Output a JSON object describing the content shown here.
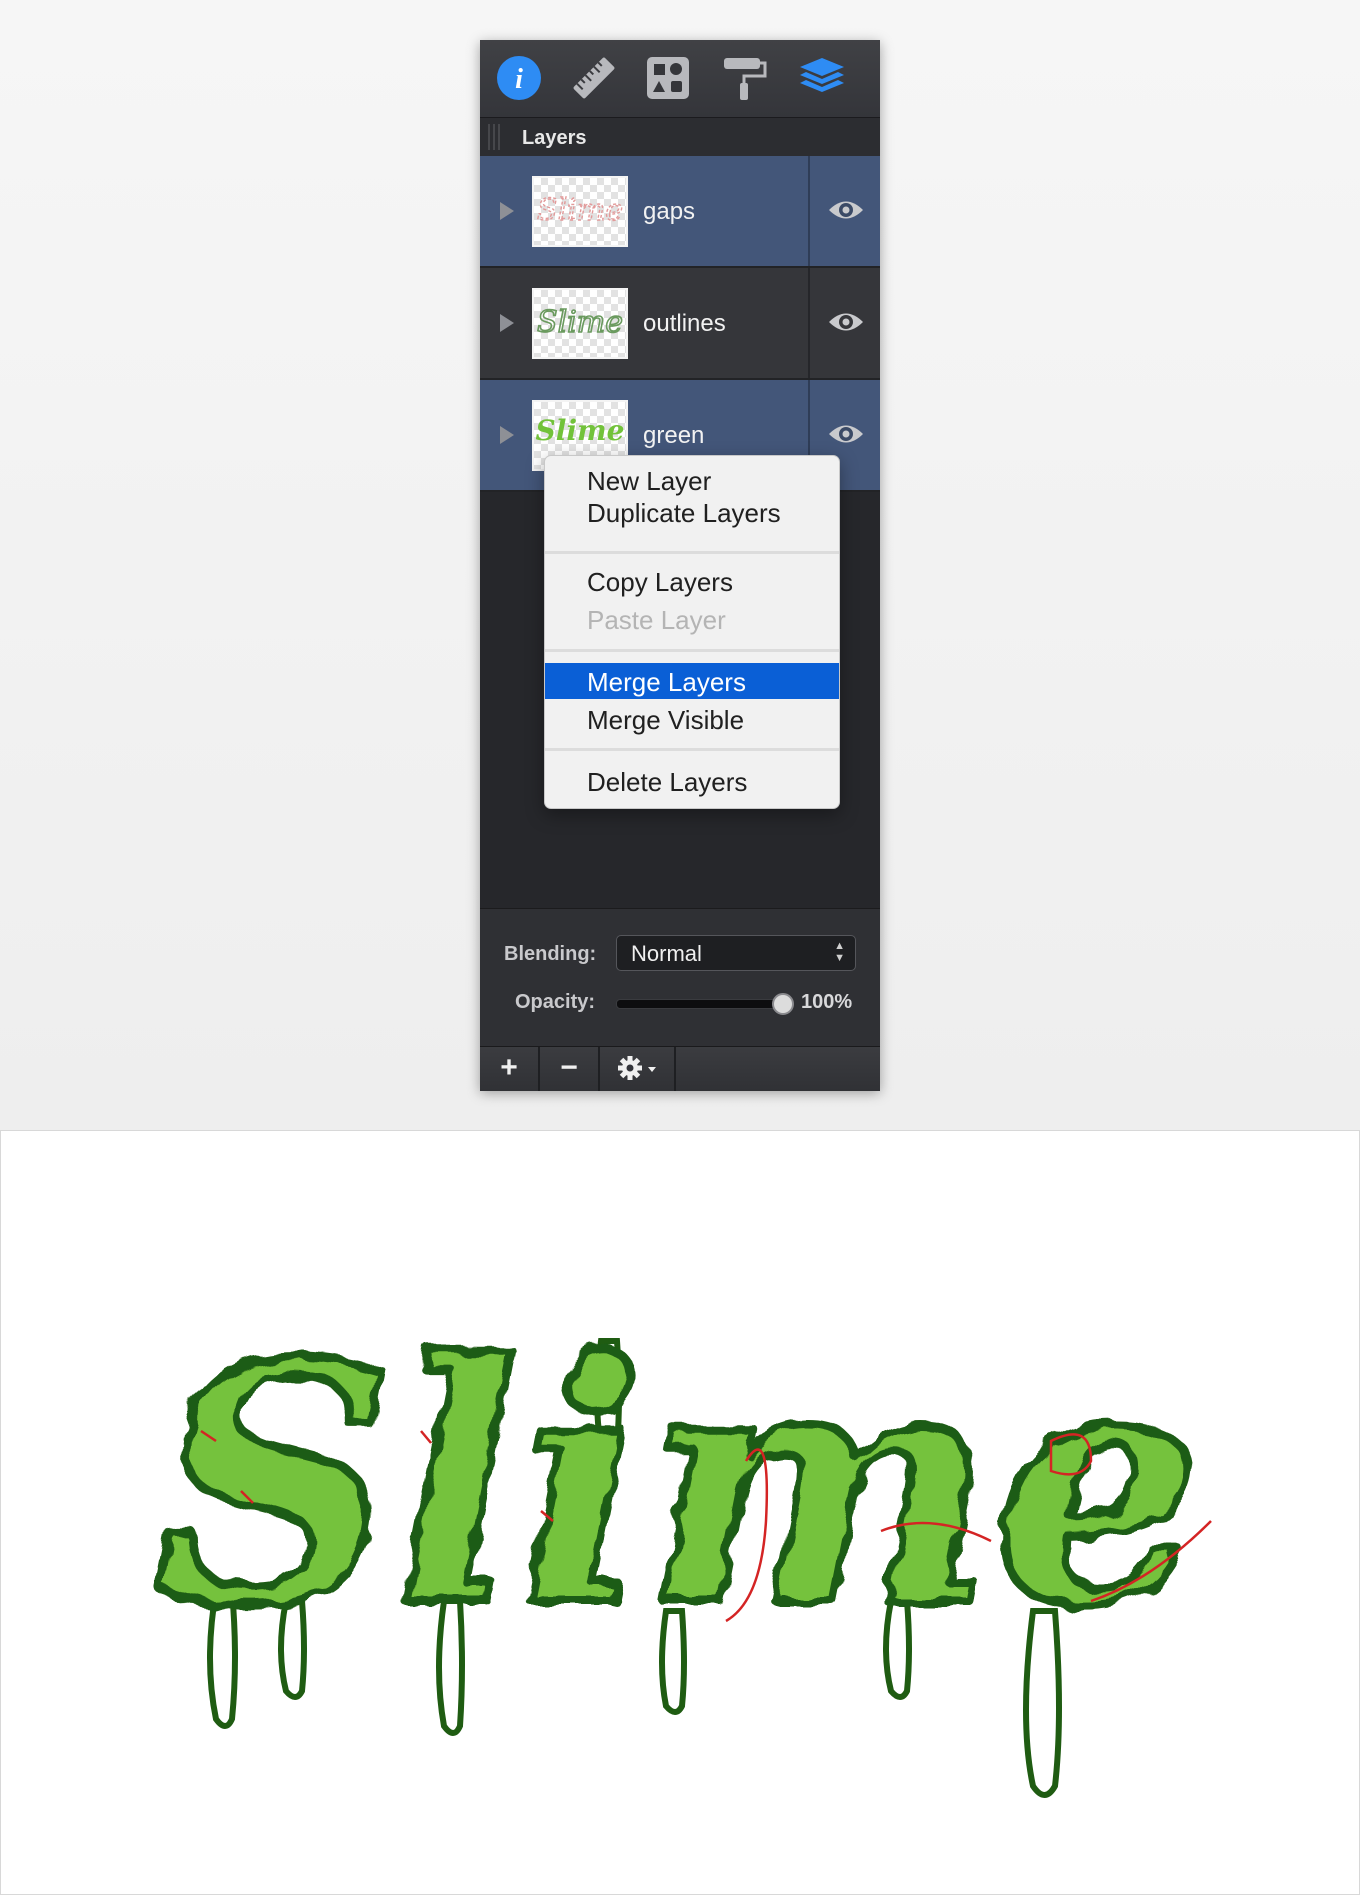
{
  "toolbar": {
    "icons": [
      "info-icon",
      "ruler-icon",
      "shapes-icon",
      "paint-roller-icon",
      "layers-icon"
    ],
    "active_icon": "layers-icon",
    "accent_color": "#2e8cf4"
  },
  "panel": {
    "title": "Layers"
  },
  "layers": [
    {
      "name": "gaps",
      "selected": true,
      "visible": true,
      "thumb_text": "Slime",
      "thumb_color": "#e8a0a0"
    },
    {
      "name": "outlines",
      "selected": false,
      "visible": true,
      "thumb_text": "Slime",
      "thumb_color": "#7aa86e"
    },
    {
      "name": "green",
      "selected": true,
      "visible": true,
      "thumb_text": "Slime",
      "thumb_color": "#72c23a"
    }
  ],
  "context_menu": {
    "items": [
      {
        "label": "New Layer",
        "enabled": true
      },
      {
        "label": "Duplicate Layers",
        "enabled": true
      },
      {
        "label": "Copy Layers",
        "enabled": true
      },
      {
        "label": "Paste Layer",
        "enabled": false
      },
      {
        "label": "Merge Layers",
        "enabled": true,
        "highlighted": true
      },
      {
        "label": "Merge Visible",
        "enabled": true
      },
      {
        "label": "Delete Layers",
        "enabled": true
      }
    ]
  },
  "blending": {
    "label": "Blending:",
    "value": "Normal"
  },
  "opacity": {
    "label": "Opacity:",
    "value_text": "100%",
    "value": 1.0
  },
  "bottom_bar": {
    "add_label": "+",
    "remove_label": "−",
    "settings_icon": "gear-icon"
  },
  "canvas": {
    "artwork_text": "Slime",
    "fill_color": "#74c23c",
    "outline_color": "#1f5c12",
    "gap_color": "#d42424"
  }
}
